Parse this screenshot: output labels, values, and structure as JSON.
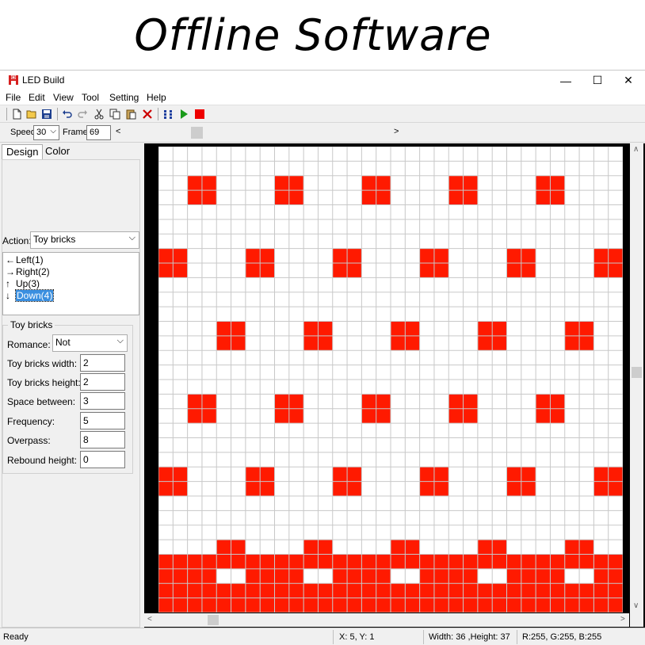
{
  "banner": {
    "title": "Offline Software"
  },
  "window": {
    "title": "LED Build",
    "controls": {
      "minimize": "—",
      "maximize": "☐",
      "close": "✕"
    }
  },
  "menu": [
    "File",
    "Edit",
    "View",
    "Tool",
    "Setting",
    "Help"
  ],
  "toolbar": {
    "icons": [
      "new-file-icon",
      "open-folder-icon",
      "save-icon",
      "undo-icon",
      "redo-icon",
      "cut-icon",
      "copy-icon",
      "paste-icon",
      "delete-icon",
      "grid-dots-icon",
      "play-icon",
      "stop-icon"
    ],
    "colors": {
      "delete": "#cc0000",
      "play": "#1a9a1a",
      "stop": "#ee0000",
      "grid": "#1f3f9f"
    }
  },
  "framebar": {
    "speed_label": "Speed:",
    "speed_value": "30",
    "frame_label": "Frame:",
    "frame_value": "69",
    "prev": "<",
    "next": ">"
  },
  "panel": {
    "tabs": [
      "Design",
      "Color"
    ],
    "active_tab": "Design",
    "action_label": "Action:",
    "action_value": "Toy bricks",
    "directions": [
      {
        "arrow": "←",
        "label": "Left(1)"
      },
      {
        "arrow": "→",
        "label": "Right(2)"
      },
      {
        "arrow": "↑",
        "label": "Up(3)"
      },
      {
        "arrow": "↓",
        "label": "Down(4)"
      }
    ],
    "selected_direction": "Down(4)",
    "group_title": "Toy bricks",
    "romance_label": "Romance:",
    "romance_value": "Not",
    "params": [
      {
        "label": "Toy bricks width:",
        "value": "2"
      },
      {
        "label": "Toy bricks height:",
        "value": "2"
      },
      {
        "label": "Space between:",
        "value": "3"
      },
      {
        "label": "Frequency:",
        "value": "5"
      },
      {
        "label": "Overpass:",
        "value": "8"
      },
      {
        "label": "Rebound height:",
        "value": "0"
      }
    ]
  },
  "led_grid": {
    "columns": 32,
    "rows": 32,
    "on_color": "#ff1a00",
    "off_color": "#ffffff",
    "grid_color": "#c8c8c8",
    "bricks": [
      [
        2,
        2
      ],
      [
        8,
        2
      ],
      [
        14,
        2
      ],
      [
        20,
        2
      ],
      [
        26,
        2
      ],
      [
        0,
        7
      ],
      [
        6,
        7
      ],
      [
        12,
        7
      ],
      [
        18,
        7
      ],
      [
        24,
        7
      ],
      [
        30,
        7
      ],
      [
        4,
        12
      ],
      [
        10,
        12
      ],
      [
        16,
        12
      ],
      [
        22,
        12
      ],
      [
        28,
        12
      ],
      [
        2,
        17
      ],
      [
        8,
        17
      ],
      [
        14,
        17
      ],
      [
        20,
        17
      ],
      [
        26,
        17
      ],
      [
        0,
        22
      ],
      [
        6,
        22
      ],
      [
        12,
        22
      ],
      [
        18,
        22
      ],
      [
        24,
        22
      ],
      [
        30,
        22
      ]
    ],
    "bottom_bumps": [
      [
        4,
        27
      ],
      [
        10,
        27
      ],
      [
        16,
        27
      ],
      [
        22,
        27
      ],
      [
        28,
        27
      ]
    ],
    "bottom_fill_rows": [
      28,
      29,
      30,
      31
    ],
    "holes_row": 29,
    "holes": [
      [
        4,
        2
      ],
      [
        10,
        2
      ],
      [
        16,
        2
      ],
      [
        22,
        2
      ],
      [
        28,
        2
      ]
    ]
  },
  "status": {
    "ready": "Ready",
    "coords": "X: 5, Y: 1",
    "size": "Width: 36 ,Height: 37",
    "rgb": "R:255, G:255, B:255"
  }
}
